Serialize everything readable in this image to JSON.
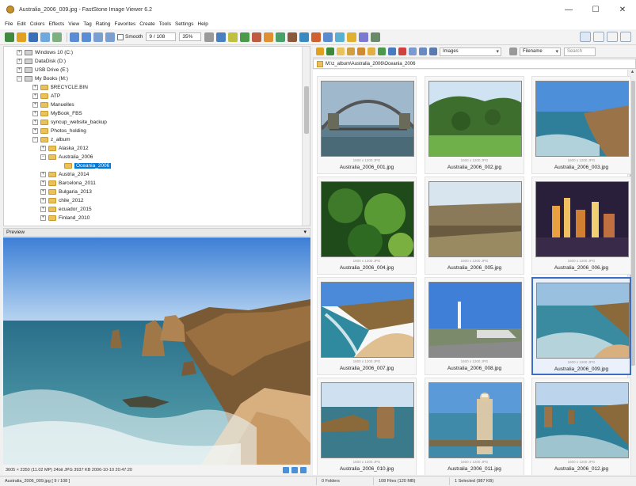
{
  "window": {
    "title": "Australia_2006_009.jpg - FastStone Image Viewer 6.2",
    "controls": [
      "—",
      "☐",
      "✕"
    ]
  },
  "menu": [
    "File",
    "Edit",
    "Colors",
    "Effects",
    "View",
    "Tag",
    "Rating",
    "Favorites",
    "Create",
    "Tools",
    "Settings",
    "Help"
  ],
  "toolbar": {
    "smooth_label": "Smooth",
    "page_field": "9 / 108",
    "zoom_field": "35%"
  },
  "tree": {
    "items": [
      {
        "label": "Windows 10 (C:)",
        "type": "drive",
        "exp": "+"
      },
      {
        "label": "DataDisk (D:)",
        "type": "drive",
        "exp": "+"
      },
      {
        "label": "USB Drive (E:)",
        "type": "drive",
        "exp": "+"
      },
      {
        "label": "My Books (M:)",
        "type": "drive",
        "exp": "−"
      },
      {
        "label": "$RECYCLE.BIN",
        "type": "folder",
        "exp": "+"
      },
      {
        "label": "ATP",
        "type": "folder",
        "exp": "+"
      },
      {
        "label": "Manuelles",
        "type": "folder",
        "exp": "+"
      },
      {
        "label": "MyBook_FBS",
        "type": "folder",
        "exp": "+"
      },
      {
        "label": "syncup_website_backup",
        "type": "folder",
        "exp": "+"
      },
      {
        "label": "Photos_holding",
        "type": "folder",
        "exp": "+"
      },
      {
        "label": "z_album",
        "type": "folder",
        "exp": "−"
      },
      {
        "label": "Alaska_2012",
        "type": "folder",
        "exp": "+"
      },
      {
        "label": "Australia_2006",
        "type": "folder",
        "exp": "−"
      },
      {
        "label": "Oceania_2006",
        "type": "folder",
        "exp": "",
        "selected": true
      },
      {
        "label": "Austria_2014",
        "type": "folder",
        "exp": "+"
      },
      {
        "label": "Barcelona_2011",
        "type": "folder",
        "exp": "+"
      },
      {
        "label": "Bulgaria_2013",
        "type": "folder",
        "exp": "+"
      },
      {
        "label": "chile_2012",
        "type": "folder",
        "exp": "+"
      },
      {
        "label": "ecuador_2015",
        "type": "folder",
        "exp": "+"
      },
      {
        "label": "Finland_2010",
        "type": "folder",
        "exp": "+"
      }
    ]
  },
  "preview": {
    "header": "Preview",
    "status": "3605 × 2350 (11.02 MP)  24bit  JPG  3937 KB  2006-10-10 20:47:20"
  },
  "browser": {
    "filter_dropdown": "Images",
    "sort_dropdown": "Filename",
    "search_placeholder": "Search",
    "address": "M:\\z_album\\Australia_2006\\Oceania_2006"
  },
  "thumbnails": [
    {
      "name": "Australia_2006_001.jpg",
      "meta": "1600 x 1200    JPG"
    },
    {
      "name": "Australia_2006_002.jpg",
      "meta": "1600 x 1200    JPG"
    },
    {
      "name": "Australia_2006_003.jpg",
      "meta": "1600 x 1200    JPG"
    },
    {
      "name": "Australia_2006_004.jpg",
      "meta": "1600 x 1200    JPG"
    },
    {
      "name": "Australia_2006_005.jpg",
      "meta": "1600 x 1200    JPG"
    },
    {
      "name": "Australia_2006_006.jpg",
      "meta": "1600 x 1200    JPG"
    },
    {
      "name": "Australia_2006_007.jpg",
      "meta": "1600 x 1200    JPG"
    },
    {
      "name": "Australia_2006_008.jpg",
      "meta": "1600 x 1200    JPG"
    },
    {
      "name": "Australia_2006_009.jpg",
      "meta": "1600 x 1200    JPG",
      "selected": true
    },
    {
      "name": "Australia_2006_010.jpg",
      "meta": "1600 x 1200    JPG"
    },
    {
      "name": "Australia_2006_011.jpg",
      "meta": "1600 x 1200    JPG"
    },
    {
      "name": "Australia_2006_012.jpg",
      "meta": "1600 x 1200    JPG"
    }
  ],
  "statusbar": {
    "file": "Australia_2006_009.jpg [ 9 / 108 ]",
    "folders": "0 Folders",
    "files": "108 Files (120 MB)",
    "selected": "1 Selected (987 KB)"
  }
}
